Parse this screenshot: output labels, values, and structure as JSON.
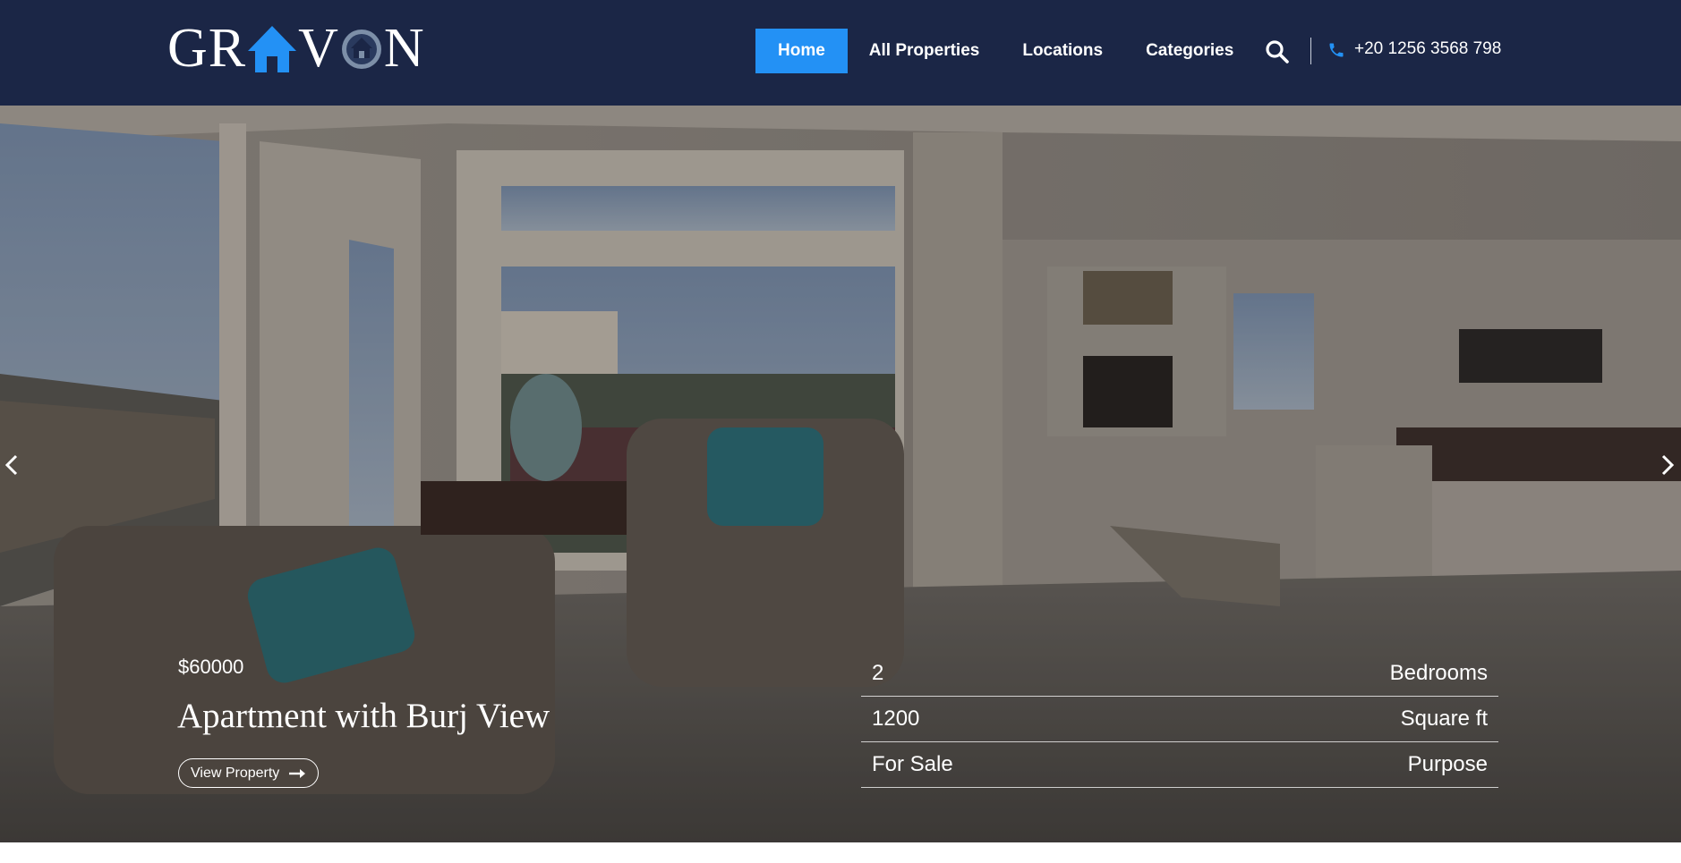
{
  "brand": {
    "logo_text": "GRAVON",
    "accent_color": "#2391f5",
    "header_bg": "#1b2646"
  },
  "nav": {
    "items": [
      {
        "label": "Home",
        "active": true
      },
      {
        "label": "All Properties",
        "active": false
      },
      {
        "label": "Locations",
        "active": false
      },
      {
        "label": "Categories",
        "active": false
      }
    ]
  },
  "header": {
    "search_icon": "search-icon",
    "phone_icon": "phone-icon",
    "phone": "+20 1256 3568 798"
  },
  "hero": {
    "price": "$60000",
    "title": "Apartment with Burj View",
    "button_label": "View Property",
    "specs": [
      {
        "value": "2",
        "label": "Bedrooms"
      },
      {
        "value": "1200",
        "label": "Square ft"
      },
      {
        "value": "For Sale",
        "label": "Purpose"
      }
    ],
    "prev_icon": "chevron-left-icon",
    "next_icon": "chevron-right-icon"
  }
}
